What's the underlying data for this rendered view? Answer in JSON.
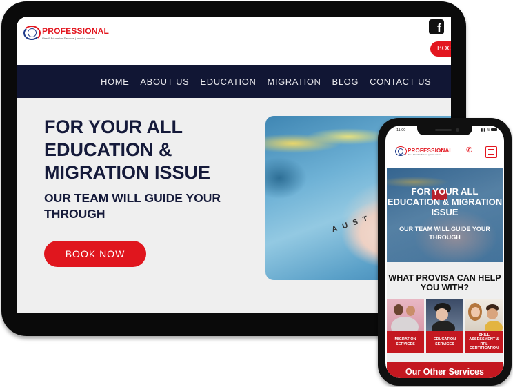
{
  "tablet": {
    "logo": {
      "brand": "PROFESSIONAL",
      "tagline": "Visa & Education Services | provisa.com.au"
    },
    "facebook_icon": "f",
    "header_book_label": "BOOK NOW",
    "nav": {
      "items": [
        {
          "label": "HOME"
        },
        {
          "label": "ABOUT US"
        },
        {
          "label": "EDUCATION"
        },
        {
          "label": "MIGRATION"
        },
        {
          "label": "BLOG"
        },
        {
          "label": "CONTACT US"
        }
      ]
    },
    "hero": {
      "title": "FOR YOUR ALL EDUCATION & MIGRATION ISSUE",
      "subtitle": "OUR TEAM WILL GUIDE YOUR THROUGH",
      "book_button": "BOOK NOW",
      "map_label": "AUST"
    }
  },
  "phone": {
    "status": {
      "time": "11:00",
      "icons": "signal-wifi-battery"
    },
    "logo": {
      "brand": "PROFESSIONAL",
      "tagline": "Visa & Education Services | provisa.com.au"
    },
    "phone_icon": "✆",
    "hero": {
      "title": "FOR YOUR ALL EDUCATION & MIGRATION ISSUE",
      "subtitle": "OUR TEAM WILL GUIDE YOUR THROUGH"
    },
    "help": {
      "title": "WHAT PROVISA CAN HELP YOU WITH?",
      "cards": [
        {
          "label": "MIGRATION SERVICES"
        },
        {
          "label": "EDUCATION SERVICES"
        },
        {
          "label": "SKILL ASSESSMENT & RPL CERTIFICATION"
        }
      ]
    },
    "other_services_title": "Our Other Services"
  },
  "colors": {
    "brand_red": "#e3161f",
    "nav_navy": "#111634",
    "heading_navy": "#151a3a",
    "card_red": "#c41820",
    "hero_bg": "#efefef"
  }
}
